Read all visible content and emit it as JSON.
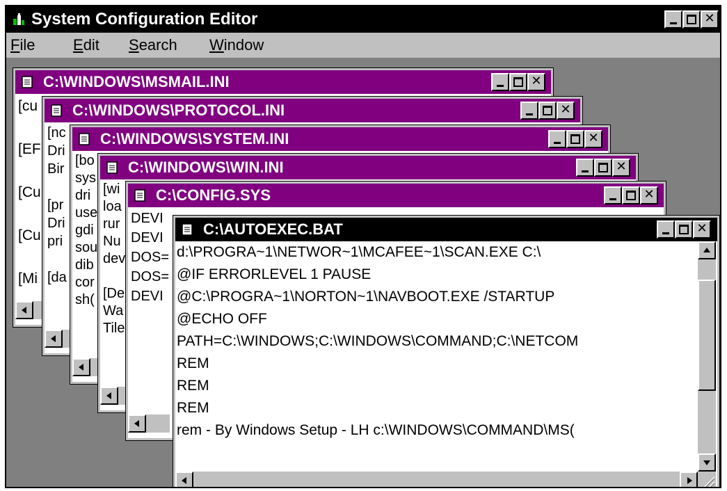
{
  "app": {
    "title": "System Configuration Editor",
    "menu": [
      {
        "label": "File",
        "mnemonic": "F",
        "rest": "ile"
      },
      {
        "label": "Edit",
        "mnemonic": "E",
        "rest": "dit"
      },
      {
        "label": "Search",
        "mnemonic": "S",
        "rest": "earch"
      },
      {
        "label": "Window",
        "mnemonic": "W",
        "rest": "indow"
      }
    ]
  },
  "windows": [
    {
      "title": "C:\\WINDOWS\\MSMAIL.INI",
      "lines": [
        "[cu",
        "",
        "[EF",
        "",
        "[Cu",
        "",
        "[Cu",
        "",
        "[Mi"
      ]
    },
    {
      "title": "C:\\WINDOWS\\PROTOCOL.INI",
      "lines": [
        "[nc",
        "Dri",
        "Bir",
        "",
        "[pr",
        "Dri",
        "pri",
        "",
        "[da"
      ]
    },
    {
      "title": "C:\\WINDOWS\\SYSTEM.INI",
      "lines": [
        "[bo",
        "sys",
        "dri",
        "use",
        "gdi",
        "sou",
        "dib",
        "cor",
        "sh("
      ]
    },
    {
      "title": "C:\\WINDOWS\\WIN.INI",
      "lines": [
        "[wi",
        "loa",
        "rur",
        "Nu",
        "dev",
        "",
        "[De",
        "Wa",
        "Tile"
      ]
    },
    {
      "title": "C:\\CONFIG.SYS",
      "lines": [
        "DEVI",
        "DEVI",
        "DOS=",
        "DOS=",
        "DEVI"
      ]
    },
    {
      "title": "C:\\AUTOEXEC.BAT",
      "lines": [
        "d:\\PROGRA~1\\NETWOR~1\\MCAFEE~1\\SCAN.EXE C:\\",
        "@IF ERRORLEVEL 1 PAUSE",
        "@C:\\PROGRA~1\\NORTON~1\\NAVBOOT.EXE /STARTUP",
        "@ECHO OFF",
        "PATH=C:\\WINDOWS;C:\\WINDOWS\\COMMAND;C:\\NETCOM",
        "REM",
        "REM",
        "REM",
        "rem - By Windows Setup - LH c:\\WINDOWS\\COMMAND\\MS("
      ]
    }
  ],
  "colors": {
    "inactive_title": "#800080",
    "active_title": "#000000",
    "mdi_background": "#808080"
  },
  "icons": {
    "app": "app-icon",
    "document": "document-icon"
  }
}
